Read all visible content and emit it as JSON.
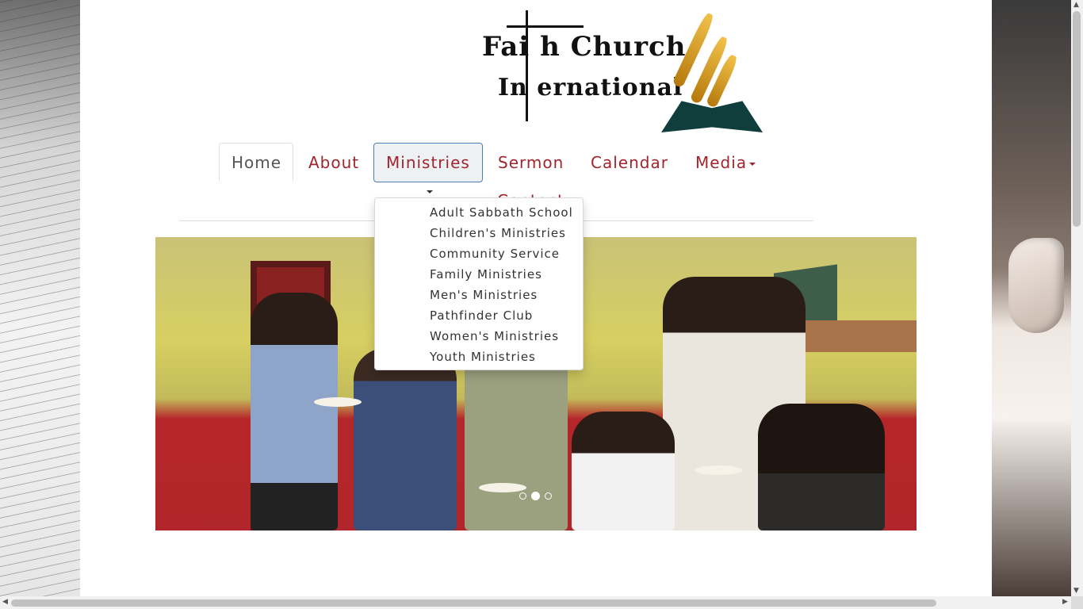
{
  "logo": {
    "line1": "Fai h Church",
    "line2": "In ernational"
  },
  "nav": {
    "items": [
      {
        "label": "Home"
      },
      {
        "label": "About"
      },
      {
        "label": "Ministries"
      },
      {
        "label": "Sermon"
      },
      {
        "label": "Calendar"
      },
      {
        "label": "Media"
      }
    ],
    "overflow_item": "Contact"
  },
  "ministries_dropdown": {
    "items": [
      "Adult Sabbath School",
      "Children's Ministries",
      "Community Service",
      "Family Ministries",
      "Men's Ministries",
      "Pathfinder Club",
      "Women's Ministries",
      "Youth Ministries"
    ]
  },
  "carousel": {
    "slide_count": 3,
    "active_slide": 2
  },
  "colors": {
    "nav_link": "#a0252c",
    "logo_book": "#0f3e3d",
    "logo_flame": "#d9a22a"
  },
  "icons": [
    "caret-down-icon",
    "scroll-up-icon",
    "scroll-down-icon",
    "scroll-left-icon",
    "scroll-right-icon"
  ]
}
